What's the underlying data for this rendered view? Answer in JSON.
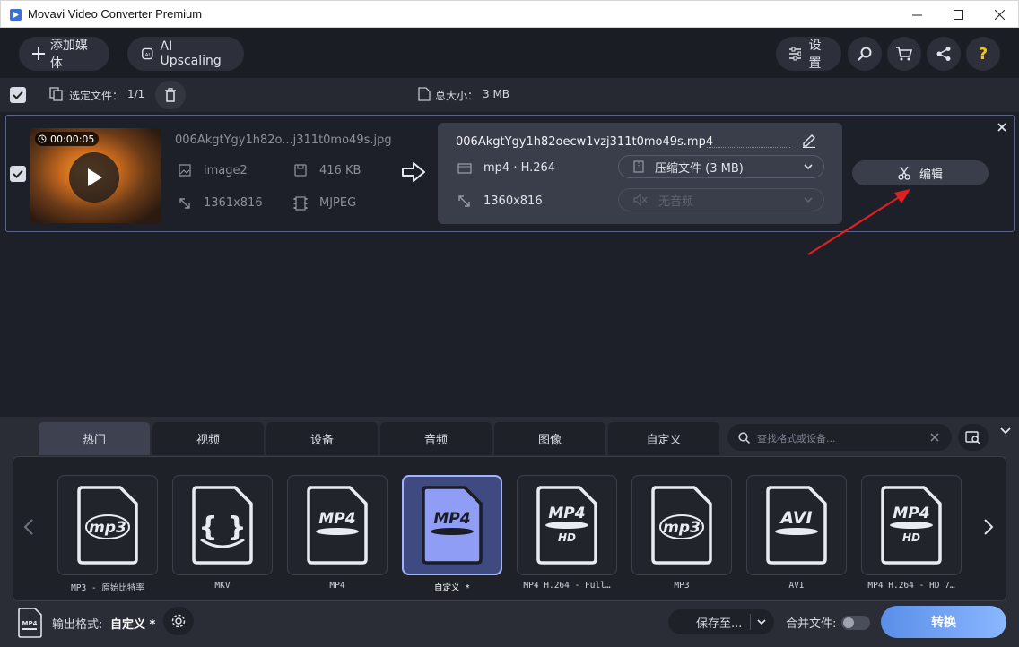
{
  "window": {
    "title": "Movavi Video Converter Premium"
  },
  "toolbar": {
    "add_media_label": "添加媒体",
    "ai_upscaling_label": "AI Upscaling",
    "settings_label": "设置"
  },
  "selection": {
    "selected_label": "选定文件：",
    "selected_count": "1/1",
    "total_size_label": "总大小：",
    "total_size": "3 MB"
  },
  "file": {
    "duration": "00:00:05",
    "input_name": "006AkgtYgy1h82o...j311t0mo49s.jpg",
    "input_codec": "image2",
    "input_size": "416 KB",
    "input_resolution": "1361x816",
    "input_format": "MJPEG",
    "output_name": "006AkgtYgy1h82oecw1vzj311t0mo49s.mp4",
    "output_format": "mp4 · H.264",
    "output_resolution": "1360x816",
    "compress_label": "压缩文件 (3 MB)",
    "audio_label": "无音频",
    "edit_label": "编辑"
  },
  "format_tabs": [
    "热门",
    "视频",
    "设备",
    "音频",
    "图像",
    "自定义"
  ],
  "search": {
    "placeholder": "查找格式或设备..."
  },
  "formats": [
    {
      "label": "MP3 - 原始比特率",
      "icon": "mp3"
    },
    {
      "label": "MKV",
      "icon": "mkv"
    },
    {
      "label": "MP4",
      "icon": "MP4"
    },
    {
      "label": "自定义 *",
      "icon": "MP4"
    },
    {
      "label": "MP4 H.264 - Full…",
      "icon": "MP4"
    },
    {
      "label": "MP3",
      "icon": "mp3"
    },
    {
      "label": "AVI",
      "icon": "AVI"
    },
    {
      "label": "MP4 H.264 - HD 7…",
      "icon": "MP4"
    }
  ],
  "bottom": {
    "output_format_label": "输出格式:",
    "output_format_value": "自定义 *",
    "save_to_label": "保存至...",
    "merge_label": "合并文件:",
    "convert_label": "转换"
  },
  "colors": {
    "accent": "#a3b4ff",
    "selected_tile": "#3e4a80",
    "annotation_arrow": "#e02020",
    "help_icon": "#f5c518"
  }
}
